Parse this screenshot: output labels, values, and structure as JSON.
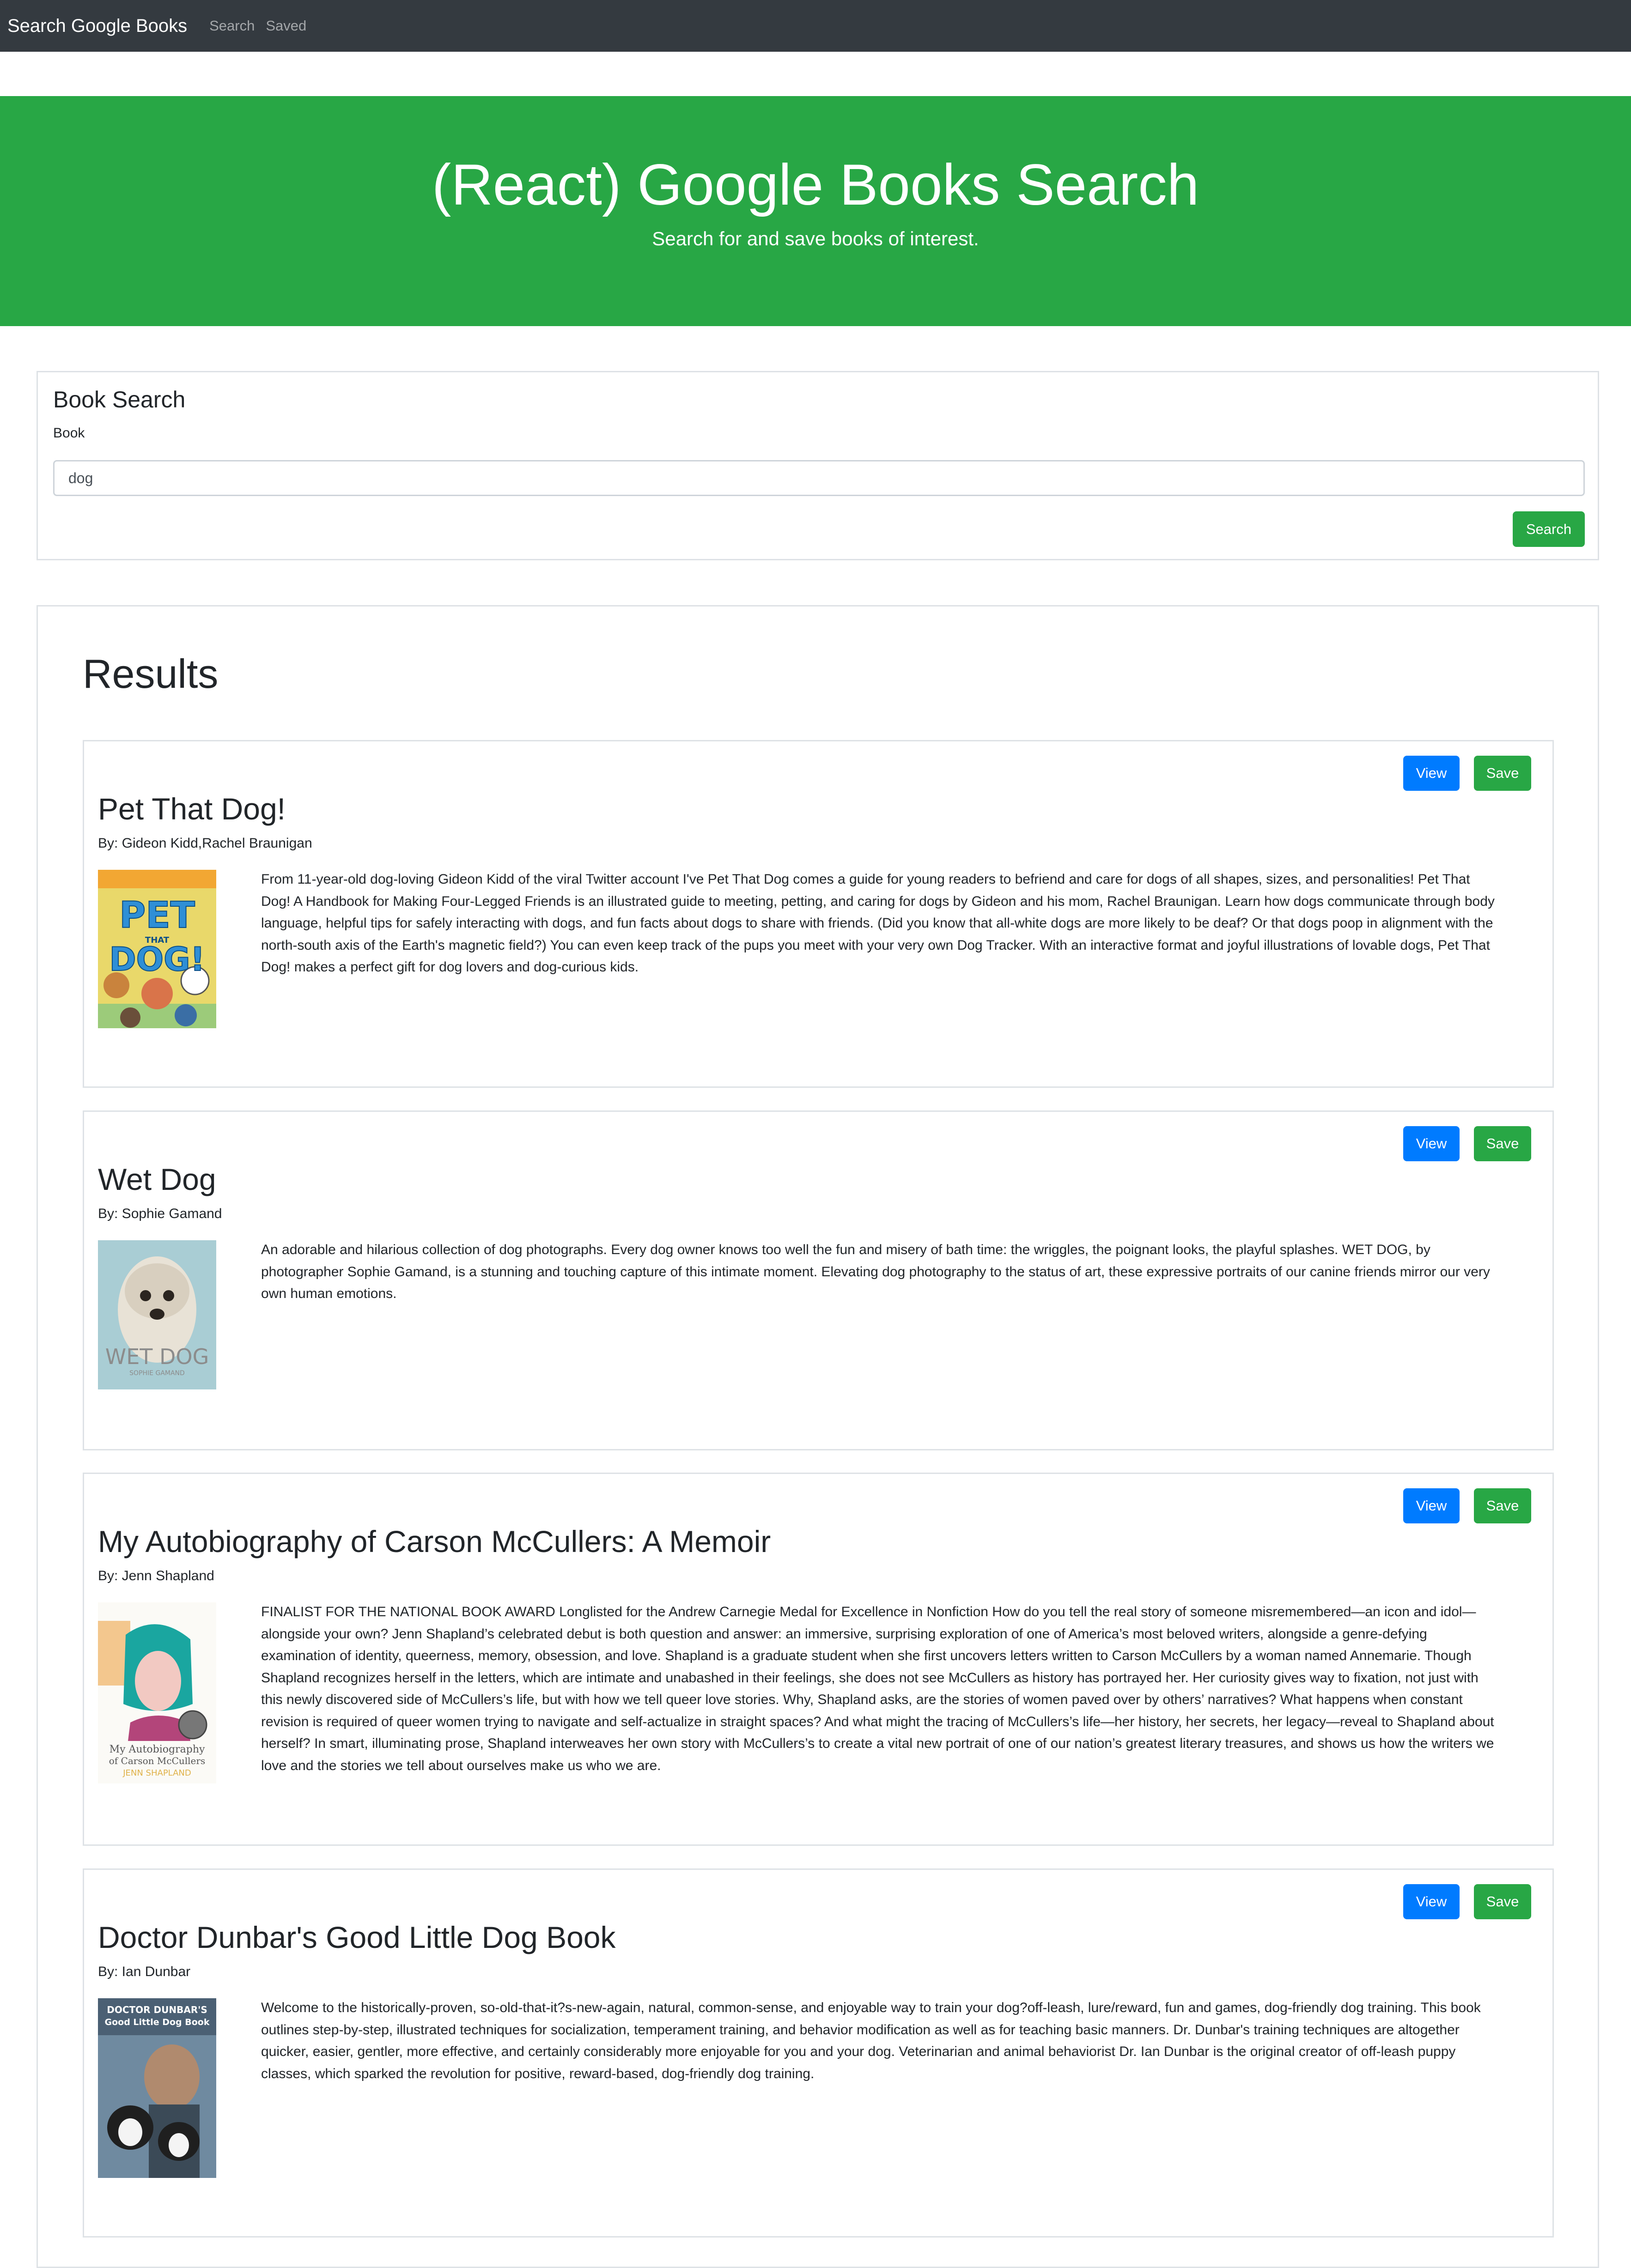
{
  "nav": {
    "brand": "Search Google Books",
    "links": [
      "Search",
      "Saved"
    ]
  },
  "jumbotron": {
    "title": "(React) Google Books Search",
    "subtitle": "Search for and save books of interest."
  },
  "search": {
    "title": "Book Search",
    "label": "Book",
    "value": "dog",
    "button": "Search"
  },
  "results": {
    "title": "Results",
    "view_label": "View",
    "save_label": "Save",
    "books": [
      {
        "title": "Pet That Dog!",
        "authors": "By: Gideon Kidd,Rachel Braunigan",
        "description": "From 11-year-old dog-loving Gideon Kidd of the viral Twitter account I've Pet That Dog comes a guide for young readers to befriend and care for dogs of all shapes, sizes, and personalities! Pet That Dog! A Handbook for Making Four-Legged Friends is an illustrated guide to meeting, petting, and caring for dogs by Gideon and his mom, Rachel Braunigan. Learn how dogs communicate through body language, helpful tips for safely interacting with dogs, and fun facts about dogs to share with friends. (Did you know that all-white dogs are more likely to be deaf? Or that dogs poop in alignment with the north-south axis of the Earth's magnetic field?) You can even keep track of the pups you meet with your very own Dog Tracker. With an interactive format and joyful illustrations of lovable dogs, Pet That Dog! makes a perfect gift for dog lovers and dog-curious kids.",
        "cover": {
          "line1": "PET",
          "line2": "THAT",
          "line3": "DOG!"
        }
      },
      {
        "title": "Wet Dog",
        "authors": "By: Sophie Gamand",
        "description": "An adorable and hilarious collection of dog photographs. Every dog owner knows too well the fun and misery of bath time: the wriggles, the poignant looks, the playful splashes. WET DOG, by photographer Sophie Gamand, is a stunning and touching capture of this intimate moment. Elevating dog photography to the status of art, these expressive portraits of our canine friends mirror our very own human emotions.",
        "cover": {
          "line1": "WET DOG",
          "line2": "SOPHIE GAMAND"
        }
      },
      {
        "title": "My Autobiography of Carson McCullers: A Memoir",
        "authors": "By: Jenn Shapland",
        "description": "FINALIST FOR THE NATIONAL BOOK AWARD Longlisted for the Andrew Carnegie Medal for Excellence in Nonfiction How do you tell the real story of someone misremembered—an icon and idol—alongside your own? Jenn Shapland’s celebrated debut is both question and answer: an immersive, surprising exploration of one of America’s most beloved writers, alongside a genre-defying examination of identity, queerness, memory, obsession, and love. Shapland is a graduate student when she first uncovers letters written to Carson McCullers by a woman named Annemarie. Though Shapland recognizes herself in the letters, which are intimate and unabashed in their feelings, she does not see McCullers as history has portrayed her. Her curiosity gives way to fixation, not just with this newly discovered side of McCullers’s life, but with how we tell queer love stories. Why, Shapland asks, are the stories of women paved over by others’ narratives? What happens when constant revision is required of queer women trying to navigate and self-actualize in straight spaces? And what might the tracing of McCullers’s life—her history, her secrets, her legacy—reveal to Shapland about herself? In smart, illuminating prose, Shapland interweaves her own story with McCullers’s to create a vital new portrait of one of our nation’s greatest literary treasures, and shows us how the writers we love and the stories we tell about ourselves make us who we are.",
        "cover": {
          "line1": "My Autobiography",
          "line2": "of Carson McCullers",
          "line3": "JENN SHAPLAND"
        }
      },
      {
        "title": "Doctor Dunbar's Good Little Dog Book",
        "authors": "By: Ian Dunbar",
        "description": "Welcome to the historically-proven, so-old-that-it?s-new-again, natural, common-sense, and enjoyable way to train your dog?off-leash, lure/reward, fun and games, dog-friendly dog training. This book outlines step-by-step, illustrated techniques for socialization, temperament training, and behavior modification as well as for teaching basic manners. Dr. Dunbar's training techniques are altogether quicker, easier, gentler, more effective, and certainly considerably more enjoyable for you and your dog. Veterinarian and animal behaviorist Dr. Ian Dunbar is the original creator of off-leash puppy classes, which sparked the revolution for positive, reward-based, dog-friendly dog training.",
        "cover": {
          "line1": "DOCTOR DUNBAR'S",
          "line2": "Good Little Dog Book"
        }
      }
    ]
  }
}
